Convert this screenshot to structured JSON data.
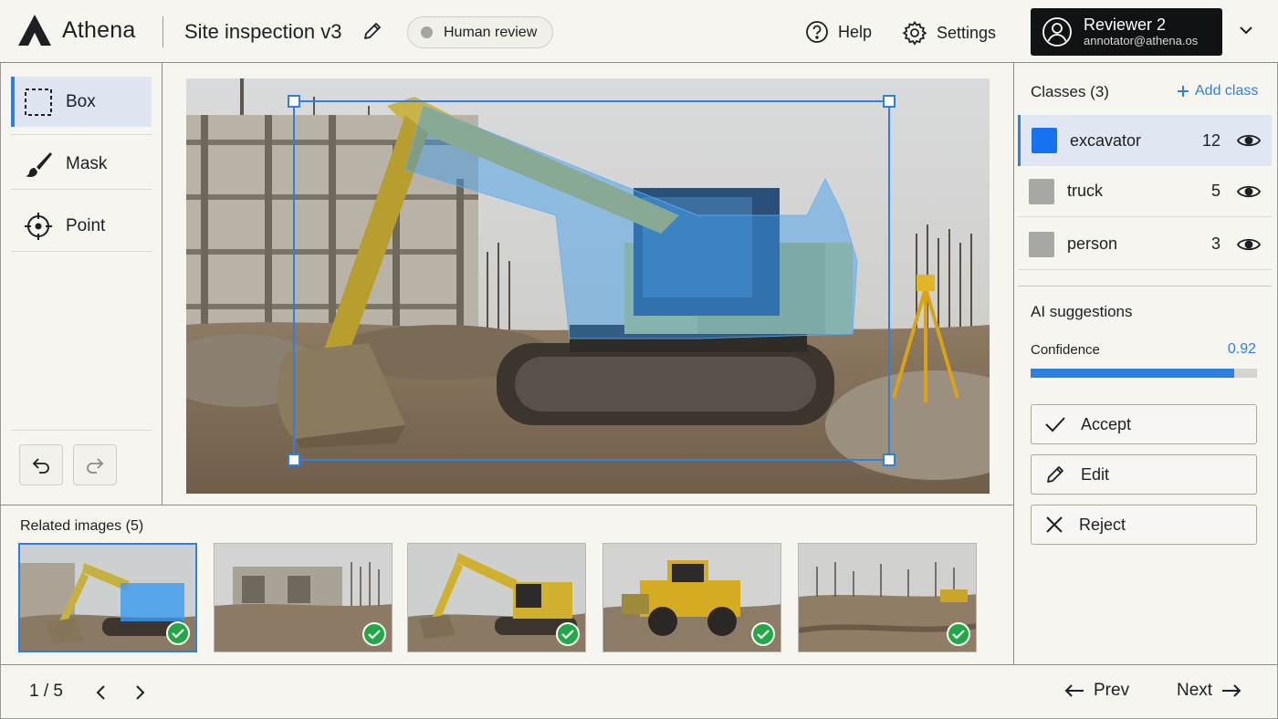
{
  "app": {
    "name": "Athena",
    "project_title": "Site inspection v3",
    "status": "Human review"
  },
  "header": {
    "help_label": "Help",
    "settings_label": "Settings"
  },
  "user": {
    "name": "Reviewer 2",
    "email": "annotator@athena.os"
  },
  "tools": [
    {
      "label": "Box",
      "icon": "box-select-icon",
      "active": true
    },
    {
      "label": "Mask",
      "icon": "brush-icon",
      "active": false
    },
    {
      "label": "Point",
      "icon": "crosshair-icon",
      "active": false
    }
  ],
  "classes": {
    "title": "Classes (3)",
    "add_label": "Add class",
    "items": [
      {
        "name": "excavator",
        "count": "12",
        "color": "#1673f0",
        "active": true
      },
      {
        "name": "truck",
        "count": "5",
        "color": "#a7a7a4",
        "active": false
      },
      {
        "name": "person",
        "count": "3",
        "color": "#a7a7a4",
        "active": false
      }
    ]
  },
  "ai": {
    "title": "AI suggestions",
    "confidence_label": "Confidence",
    "confidence_value": "0.92",
    "confidence_fraction": 0.9,
    "accept_label": "Accept",
    "edit_label": "Edit",
    "reject_label": "Reject"
  },
  "related": {
    "title": "Related images (5)",
    "thumbs": [
      {
        "scene": "excavator-highlighted",
        "reviewed": true,
        "active": true
      },
      {
        "scene": "concrete-structure",
        "reviewed": true,
        "active": false
      },
      {
        "scene": "excavator",
        "reviewed": true,
        "active": false
      },
      {
        "scene": "wheel-loader",
        "reviewed": true,
        "active": false
      },
      {
        "scene": "site-overview",
        "reviewed": true,
        "active": false
      }
    ]
  },
  "pagination": {
    "label": "1 / 5",
    "prev_label": "Prev",
    "next_label": "Next"
  },
  "colors": {
    "accent": "#2f7fe0",
    "annotation_fill": "#3a9bf0",
    "header_user_bg": "#111213",
    "check_green": "#23a848"
  }
}
